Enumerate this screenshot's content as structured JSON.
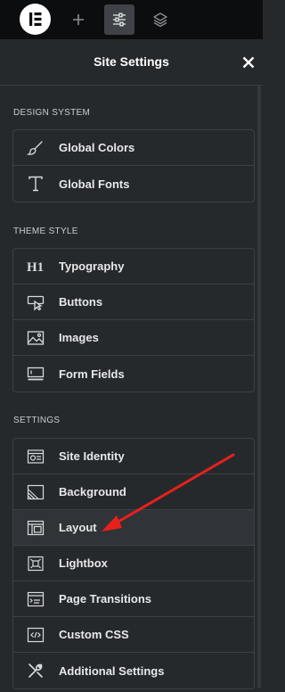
{
  "topbar": {
    "logo_icon": "elementor-logo-icon",
    "add_icon": "plus-icon",
    "settings_icon": "sliders-icon",
    "layers_icon": "layers-icon"
  },
  "panel": {
    "title": "Site Settings",
    "close_icon": "close-icon"
  },
  "sections": {
    "design_system": {
      "title": "DESIGN SYSTEM",
      "items": [
        {
          "label": "Global Colors",
          "icon": "paintbrush-icon"
        },
        {
          "label": "Global Fonts",
          "icon": "text-t-icon"
        }
      ]
    },
    "theme_style": {
      "title": "THEME STYLE",
      "items": [
        {
          "label": "Typography",
          "icon": "heading-h1-icon"
        },
        {
          "label": "Buttons",
          "icon": "button-cursor-icon"
        },
        {
          "label": "Images",
          "icon": "image-icon"
        },
        {
          "label": "Form Fields",
          "icon": "form-field-icon"
        }
      ]
    },
    "settings": {
      "title": "SETTINGS",
      "items": [
        {
          "label": "Site Identity",
          "icon": "id-card-icon"
        },
        {
          "label": "Background",
          "icon": "background-icon"
        },
        {
          "label": "Layout",
          "icon": "layout-icon"
        },
        {
          "label": "Lightbox",
          "icon": "lightbox-icon"
        },
        {
          "label": "Page Transitions",
          "icon": "page-transition-icon"
        },
        {
          "label": "Custom CSS",
          "icon": "code-icon"
        },
        {
          "label": "Additional Settings",
          "icon": "tools-icon"
        }
      ]
    }
  },
  "annotation": {
    "arrow_color": "#e8201c",
    "points_to": "Layout"
  }
}
